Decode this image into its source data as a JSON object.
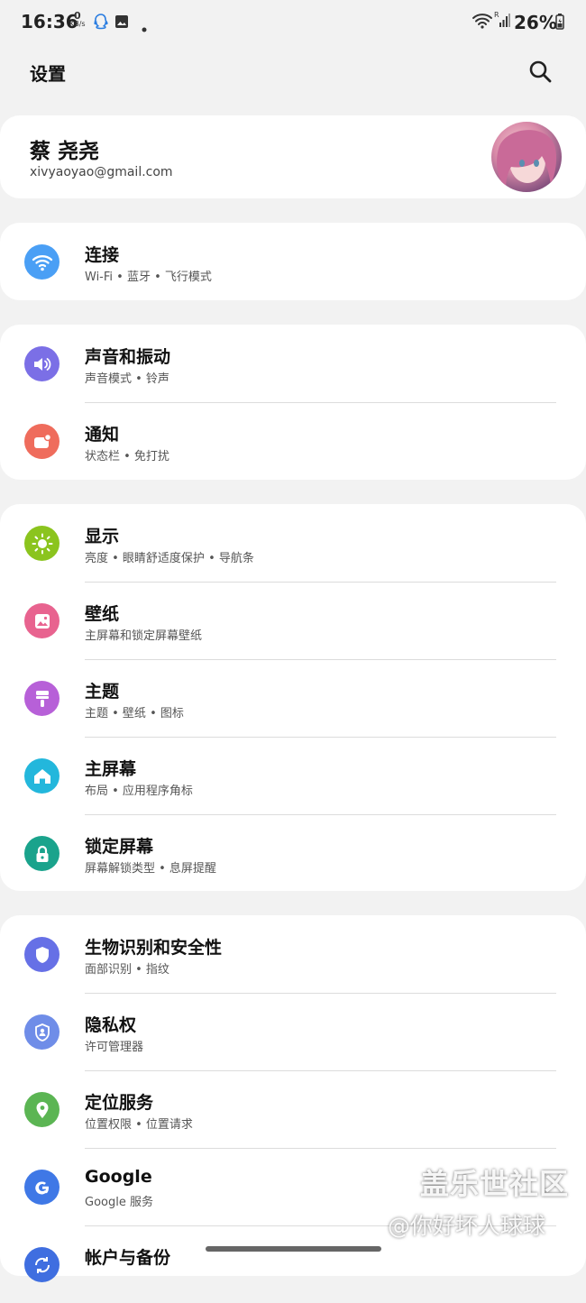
{
  "status_bar": {
    "time": "16:36",
    "net_speed_value": "0",
    "net_speed_unit": "KB/s",
    "battery": "26%",
    "left_icons": [
      "qq-icon",
      "image-icon",
      "dot-icon"
    ],
    "right_icons": [
      "wifi-icon",
      "signal-icon",
      "battery-icon"
    ]
  },
  "header": {
    "title": "设置",
    "search_icon": "search-icon"
  },
  "profile": {
    "name": "蔡 尧尧",
    "email": "xivyaoyao@gmail.com"
  },
  "settings": [
    {
      "title": "连接",
      "subtitle": "Wi-Fi  •  蓝牙  •  飞行模式",
      "icon": "wifi-icon",
      "color": "#4a9ff5"
    },
    {
      "title": "声音和振动",
      "subtitle": "声音模式  •  铃声",
      "icon": "volume-icon",
      "color": "#7b6fe6"
    },
    {
      "title": "通知",
      "subtitle": "状态栏  •  免打扰",
      "icon": "notification-icon",
      "color": "#ef6c5c"
    },
    {
      "title": "显示",
      "subtitle": "亮度  •  眼睛舒适度保护  •  导航条",
      "icon": "brightness-icon",
      "color": "#8bc41e"
    },
    {
      "title": "壁纸",
      "subtitle": "主屏幕和锁定屏幕壁纸",
      "icon": "wallpaper-icon",
      "color": "#e8638f"
    },
    {
      "title": "主题",
      "subtitle": "主题  •  壁纸  •  图标",
      "icon": "theme-brush-icon",
      "color": "#b760d8"
    },
    {
      "title": "主屏幕",
      "subtitle": "布局  •  应用程序角标",
      "icon": "home-icon",
      "color": "#23b7dc"
    },
    {
      "title": "锁定屏幕",
      "subtitle": "屏幕解锁类型  •  息屏提醒",
      "icon": "lock-icon",
      "color": "#1aa38c"
    },
    {
      "title": "生物识别和安全性",
      "subtitle": "面部识别  •  指纹",
      "icon": "shield-icon",
      "color": "#6670e6"
    },
    {
      "title": "隐私权",
      "subtitle": "许可管理器",
      "icon": "privacy-icon",
      "color": "#6f8de8"
    },
    {
      "title": "定位服务",
      "subtitle": "位置权限  •  位置请求",
      "icon": "location-pin-icon",
      "color": "#5bb553"
    },
    {
      "title": "Google",
      "subtitle": "Google 服务",
      "icon": "google-icon",
      "color": "#3f78e6"
    },
    {
      "title": "帐户与备份",
      "subtitle": "",
      "icon": "sync-icon",
      "color": "#3f6ee0"
    }
  ],
  "watermark": {
    "line1": "盖乐世社区",
    "line2": "@你好坏人球球"
  }
}
